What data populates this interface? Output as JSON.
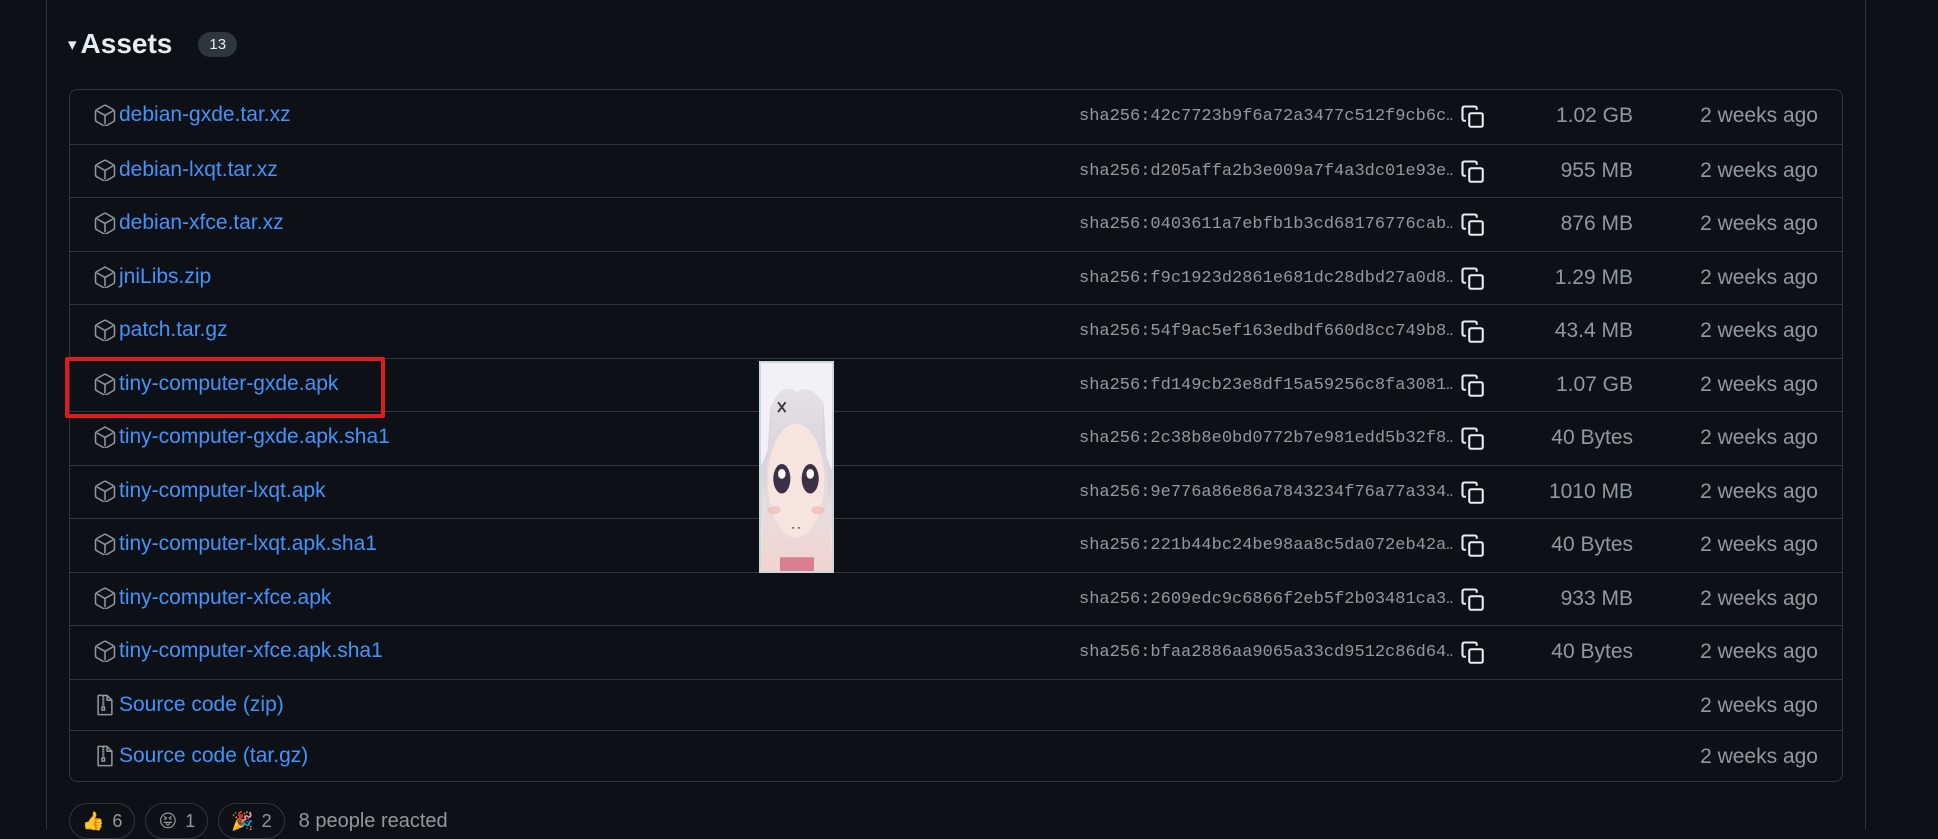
{
  "assets": {
    "caret": "▾",
    "title": "Assets",
    "count": "13",
    "rows": [
      {
        "name": "debian-gxde.tar.xz",
        "sha": "sha256:42c7723b9f6a72a3477c512f9cb6c…",
        "size": "1.02 GB",
        "date": "2 weeks ago"
      },
      {
        "name": "debian-lxqt.tar.xz",
        "sha": "sha256:d205affa2b3e009a7f4a3dc01e93e…",
        "size": "955 MB",
        "date": "2 weeks ago"
      },
      {
        "name": "debian-xfce.tar.xz",
        "sha": "sha256:0403611a7ebfb1b3cd68176776cab…",
        "size": "876 MB",
        "date": "2 weeks ago"
      },
      {
        "name": "jniLibs.zip",
        "sha": "sha256:f9c1923d2861e681dc28dbd27a0d8…",
        "size": "1.29 MB",
        "date": "2 weeks ago"
      },
      {
        "name": "patch.tar.gz",
        "sha": "sha256:54f9ac5ef163edbdf660d8cc749b8…",
        "size": "43.4 MB",
        "date": "2 weeks ago"
      },
      {
        "name": "tiny-computer-gxde.apk",
        "sha": "sha256:fd149cb23e8df15a59256c8fa3081…",
        "size": "1.07 GB",
        "date": "2 weeks ago"
      },
      {
        "name": "tiny-computer-gxde.apk.sha1",
        "sha": "sha256:2c38b8e0bd0772b7e981edd5b32f8…",
        "size": "40 Bytes",
        "date": "2 weeks ago"
      },
      {
        "name": "tiny-computer-lxqt.apk",
        "sha": "sha256:9e776a86e86a7843234f76a77a334…",
        "size": "1010 MB",
        "date": "2 weeks ago"
      },
      {
        "name": "tiny-computer-lxqt.apk.sha1",
        "sha": "sha256:221b44bc24be98aa8c5da072eb42a…",
        "size": "40 Bytes",
        "date": "2 weeks ago"
      },
      {
        "name": "tiny-computer-xfce.apk",
        "sha": "sha256:2609edc9c6866f2eb5f2b03481ca3…",
        "size": "933 MB",
        "date": "2 weeks ago"
      },
      {
        "name": "tiny-computer-xfce.apk.sha1",
        "sha": "sha256:bfaa2886aa9065a33cd9512c86d64…",
        "size": "40 Bytes",
        "date": "2 weeks ago"
      }
    ],
    "source_rows": [
      {
        "name": "Source code",
        "suffix": "(zip)",
        "date": "2 weeks ago"
      },
      {
        "name": "Source code",
        "suffix": "(tar.gz)",
        "date": "2 weeks ago"
      }
    ],
    "highlighted_row": "tiny-computer-gxde.apk"
  },
  "reactions": {
    "items": [
      {
        "emoji": "👍",
        "count": "6",
        "icon": "thumbs-up-icon"
      },
      {
        "emoji": "😝",
        "count": "1",
        "icon": "laugh-icon"
      },
      {
        "emoji": "🎉",
        "count": "2",
        "icon": "hooray-icon"
      }
    ],
    "summary": "8 people reacted"
  },
  "colors": {
    "background": "#0d1117",
    "link": "#4493f8",
    "muted": "#9198a1",
    "border": "#30363d",
    "highlight": "#e01b1b"
  }
}
